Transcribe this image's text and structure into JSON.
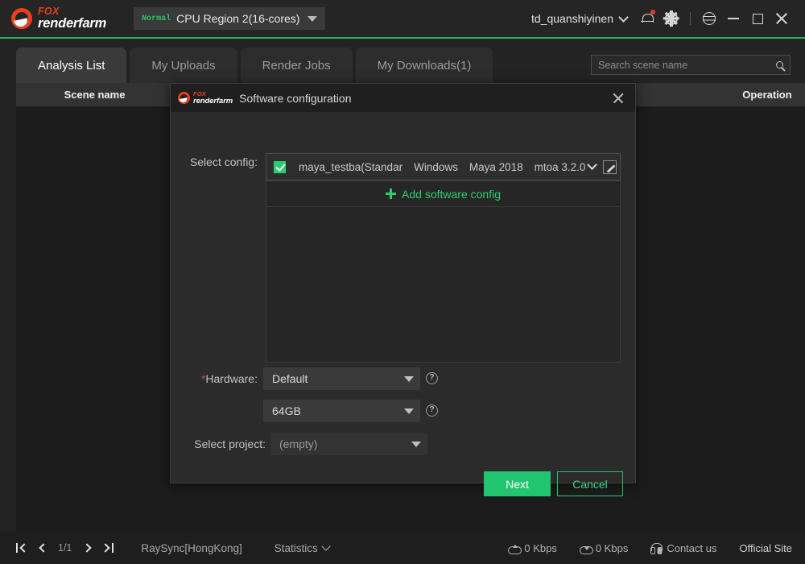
{
  "titlebar": {
    "logo_fox": "FOX",
    "logo_name": "renderfarm",
    "region_badge": "Normal",
    "region_label": "CPU Region 2(16-cores)",
    "username": "td_quanshiyinen",
    "icons": [
      "bell-icon",
      "gear-icon",
      "globe-icon",
      "minimize-icon",
      "maximize-icon",
      "close-icon"
    ],
    "accent_green": "#27ae60"
  },
  "tabs": [
    {
      "label": "Analysis List",
      "active": true
    },
    {
      "label": "My Uploads",
      "active": false
    },
    {
      "label": "Render Jobs",
      "active": false
    },
    {
      "label": "My Downloads(1)",
      "active": false
    }
  ],
  "search": {
    "placeholder": "Search scene name",
    "value": "",
    "icon": "search-icon"
  },
  "table": {
    "columns": [
      "Scene name",
      "Operation"
    ],
    "rows": []
  },
  "dialog": {
    "logo_fox": "FOX",
    "logo_name": "renderfarm",
    "title": "Software configuration",
    "close_icon": "close-icon",
    "select_config_label": "Select config:",
    "config_row": {
      "checked": true,
      "name": "maya_testba(Standar",
      "os": "Windows",
      "software": "Maya 2018",
      "plugin": "mtoa 3.2.0",
      "dropdown_icon": "chevron-down-icon",
      "edit_icon": "edit-pencil-icon"
    },
    "add_config_label": "Add software config",
    "hardware_label": "Hardware:",
    "hardware_required": "*",
    "hardware_value": "Default",
    "memory_value": "64GB",
    "select_project_label": "Select project:",
    "project_value": "(empty)",
    "help_icon": "help-circle-icon",
    "buttons": {
      "next": "Next",
      "cancel": "Cancel"
    },
    "colors": {
      "primary": "#21c46f",
      "checkbox": "#2ecc71",
      "link": "#2ecc71"
    }
  },
  "statusbar": {
    "pager": {
      "first_icon": "first-page-icon",
      "prev_icon": "prev-page-icon",
      "page": "1/1",
      "next_icon": "next-page-icon",
      "last_icon": "last-page-icon"
    },
    "raysync": "RaySync[HongKong]",
    "statistics": "Statistics",
    "upload_rate": "0 Kbps",
    "download_rate": "0 Kbps",
    "contact": "Contact us",
    "official_site": "Official Site"
  }
}
